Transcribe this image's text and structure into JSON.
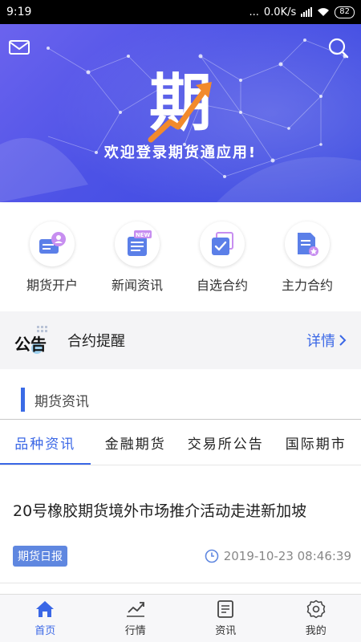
{
  "status_bar": {
    "time": "9:19",
    "dots": "...",
    "speed": "0.0K/s",
    "battery": "82"
  },
  "banner": {
    "logo_char": "期",
    "welcome": "欢迎登录期货通应用!"
  },
  "quick_menu": [
    {
      "label": "期货开户",
      "icon": "account-icon"
    },
    {
      "label": "新闻资讯",
      "icon": "news-icon",
      "badge": "NEW"
    },
    {
      "label": "自选合约",
      "icon": "watchlist-icon"
    },
    {
      "label": "主力合约",
      "icon": "main-contract-icon"
    }
  ],
  "notice": {
    "badge_text": "公告",
    "text": "合约提醒",
    "more": "详情"
  },
  "section": {
    "title": "期货资讯"
  },
  "tabs": [
    {
      "label": "品种资讯",
      "active": true
    },
    {
      "label": "金融期货",
      "active": false
    },
    {
      "label": "交易所公告",
      "active": false
    },
    {
      "label": "国际期市",
      "active": false
    }
  ],
  "news": [
    {
      "title": "20号橡胶期货境外市场推介活动走进新加坡",
      "tag": "期货日报",
      "time": "2019-10-23 08:46:39"
    }
  ],
  "bottom_nav": [
    {
      "label": "首页",
      "icon": "home-icon",
      "active": true
    },
    {
      "label": "行情",
      "icon": "chart-icon",
      "active": false
    },
    {
      "label": "资讯",
      "icon": "document-icon",
      "active": false
    },
    {
      "label": "我的",
      "icon": "settings-icon",
      "active": false
    }
  ],
  "colors": {
    "accent": "#3a67e6",
    "banner": "#4c52e6",
    "tag": "#5f87e0"
  }
}
